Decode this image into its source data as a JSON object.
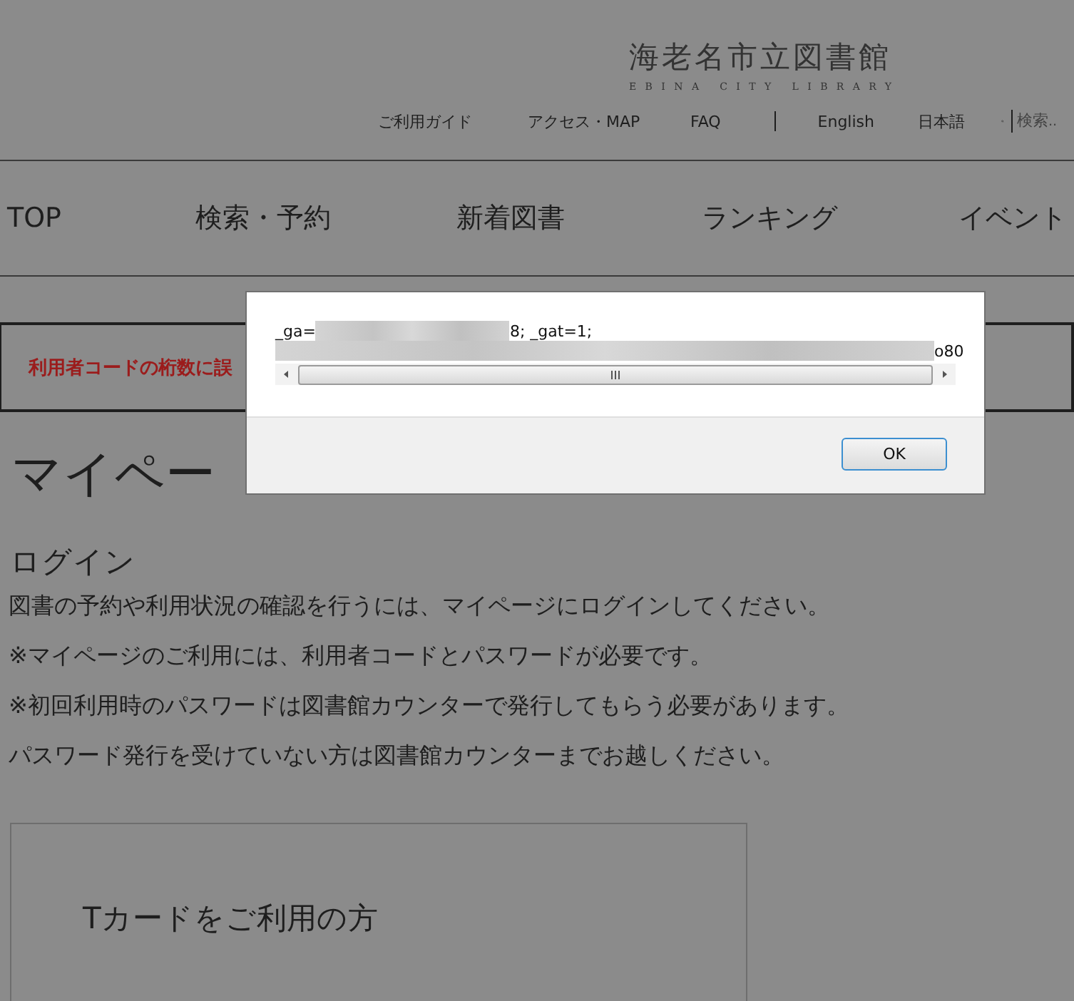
{
  "header": {
    "logo": {
      "title": "海老名市立図書館",
      "subtitle": "EBINA CITY LIBRARY"
    },
    "utility_links": [
      "ご利用ガイド",
      "アクセス・MAP",
      "FAQ"
    ],
    "language_links": [
      "English",
      "日本語"
    ],
    "search": {
      "placeholder": "検索.."
    }
  },
  "main_nav": [
    "TOP",
    "検索・予約",
    "新着図書",
    "ランキング",
    "イベント"
  ],
  "error_message": "利用者コードの桁数に誤",
  "page_title": "マイペー",
  "login": {
    "heading": "ログイン",
    "paragraphs": [
      "図書の予約や利用状況の確認を行うには、マイページにログインしてください。",
      "※マイページのご利用には、利用者コードとパスワードが必要です。",
      "※初回利用時のパスワードは図書館カウンターで発行してもらう必要があります。",
      "パスワード発行を受けていない方は図書館カウンターまでお越しください。"
    ]
  },
  "card_section": {
    "heading": "Tカードをご利用の方"
  },
  "dialog": {
    "line_1": {
      "prefix": "_ga=",
      "suffix": "8; _gat=1;"
    },
    "line_2": {
      "suffix": "o80"
    },
    "ok_button": "OK"
  }
}
